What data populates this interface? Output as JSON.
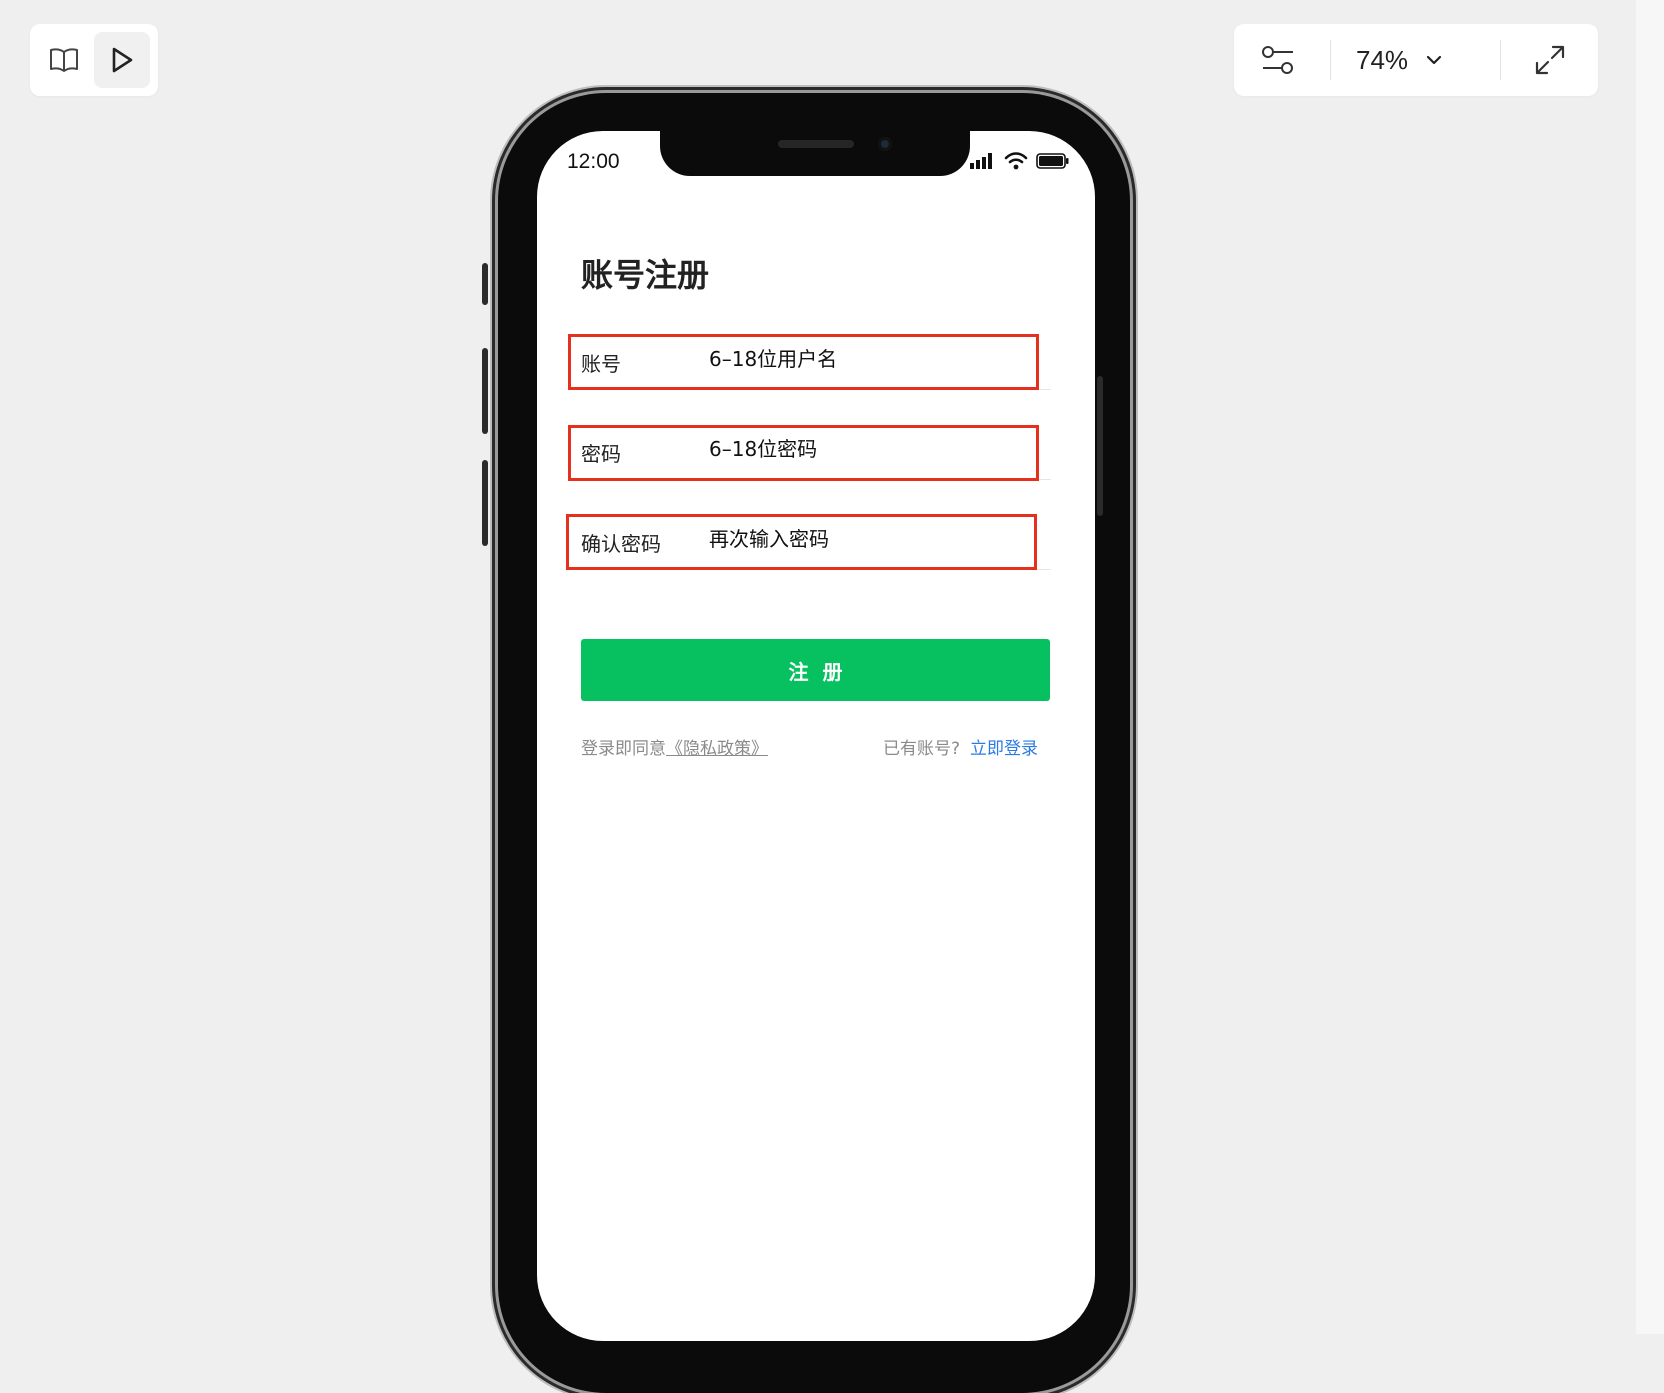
{
  "toolbar": {
    "left": {
      "docs_icon": "book-open-icon",
      "play_icon": "play-icon"
    },
    "right": {
      "settings_icon": "sliders-icon",
      "zoom_level": "74%",
      "zoom_icon": "chevron-down-icon",
      "fullscreen_icon": "expand-arrows-icon"
    }
  },
  "phone": {
    "status_bar": {
      "time": "12:00",
      "icons": [
        "signal-icon",
        "wifi-icon",
        "battery-icon"
      ]
    }
  },
  "screen": {
    "title": "账号注册",
    "fields": [
      {
        "label": "账号",
        "placeholder": "6–18位用户名"
      },
      {
        "label": "密码",
        "placeholder": "6–18位密码"
      },
      {
        "label": "确认密码",
        "placeholder": "再次输入密码"
      }
    ],
    "register_button": "注册",
    "footer": {
      "agree_prefix": "登录即同意",
      "policy_link": "《隐私政策》",
      "has_account": "已有账号?",
      "login_link": "立即登录"
    }
  },
  "colors": {
    "primary": "#07c160",
    "link": "#2c7be5",
    "highlight": "#e5301d",
    "background": "#efefef"
  }
}
